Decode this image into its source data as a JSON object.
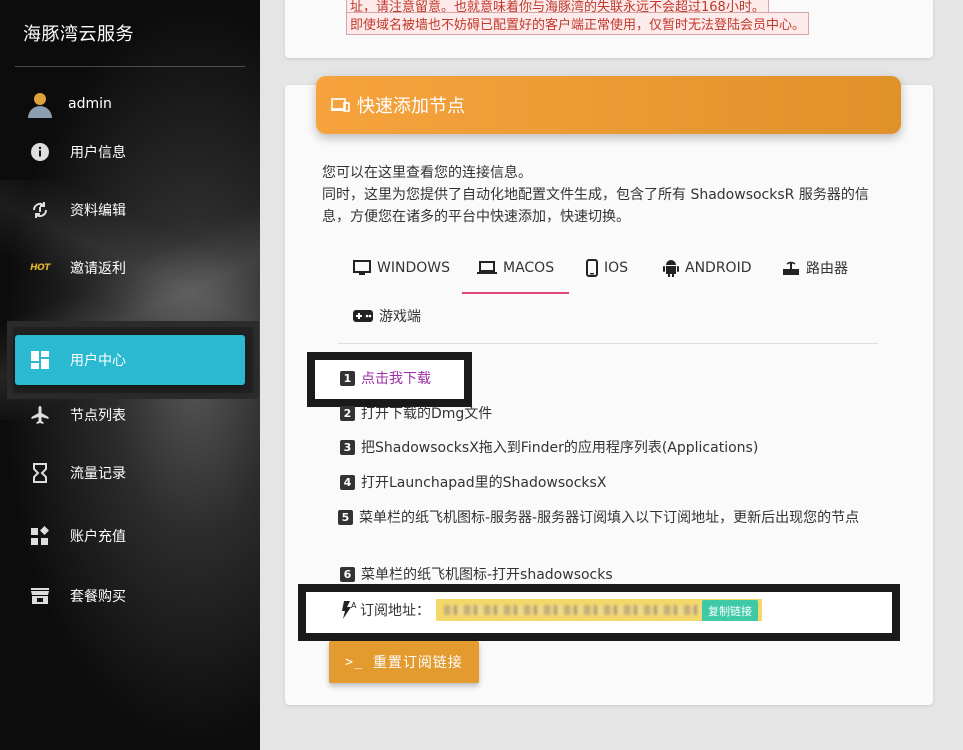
{
  "sidebar": {
    "brand": "海豚湾云服务",
    "user": "admin",
    "items": [
      {
        "label": "用户信息",
        "icon": "info-icon"
      },
      {
        "label": "资料编辑",
        "icon": "sync-icon"
      },
      {
        "label": "邀请返利",
        "icon": "hot-icon"
      },
      {
        "label": "用户中心",
        "icon": "dashboard-icon",
        "active": true
      },
      {
        "label": "节点列表",
        "icon": "airplane-icon"
      },
      {
        "label": "流量记录",
        "icon": "hourglass-icon"
      },
      {
        "label": "账户充值",
        "icon": "widgets-icon"
      },
      {
        "label": "套餐购买",
        "icon": "store-icon"
      }
    ],
    "hot_badge": "HOT",
    "active_color": "#2bb9d2"
  },
  "notice": {
    "line1": "址，请注意留意。也就意味着你与海豚湾的失联永远不会超过168小时。",
    "line2": "即使域名被墙也不妨碍已配置好的客户端正常使用，仅暂时无法登陆会员中心。"
  },
  "card": {
    "title": "快速添加节点",
    "desc1": "您可以在这里查看您的连接信息。",
    "desc2": "同时，这里为您提供了自动化地配置文件生成，包含了所有 ShadowsocksR 服务器的信息，方便您在诸多的平台中快速添加，快速切换。",
    "header_color": "#f0a038"
  },
  "tabs": [
    {
      "label": "WINDOWS",
      "icon": "monitor-icon"
    },
    {
      "label": "MACOS",
      "icon": "laptop-icon",
      "active": true
    },
    {
      "label": "IOS",
      "icon": "phone-icon"
    },
    {
      "label": "ANDROID",
      "icon": "android-icon"
    },
    {
      "label": "路由器",
      "icon": "router-icon"
    },
    {
      "label": "游戏端",
      "icon": "gamepad-icon"
    }
  ],
  "steps": [
    {
      "num": "1",
      "text": "点击我下载",
      "link": true
    },
    {
      "num": "2",
      "text": "打开下载的Dmg文件"
    },
    {
      "num": "3",
      "text": "把ShadowsocksX拖入到Finder的应用程序列表(Applications)"
    },
    {
      "num": "4",
      "text": "打开Launchapad里的ShadowsocksX"
    },
    {
      "num": "5",
      "text": "菜单栏的纸飞机图标-服务器-服务器订阅填入以下订阅地址，更新后出现您的节点"
    },
    {
      "num": "6",
      "text": "菜单栏的纸飞机图标-打开shadowsocks"
    }
  ],
  "subscription": {
    "label": "订阅地址：",
    "copy": "复制链接"
  },
  "reset_button": {
    "prompt": ">_",
    "label": "重置订阅链接"
  }
}
